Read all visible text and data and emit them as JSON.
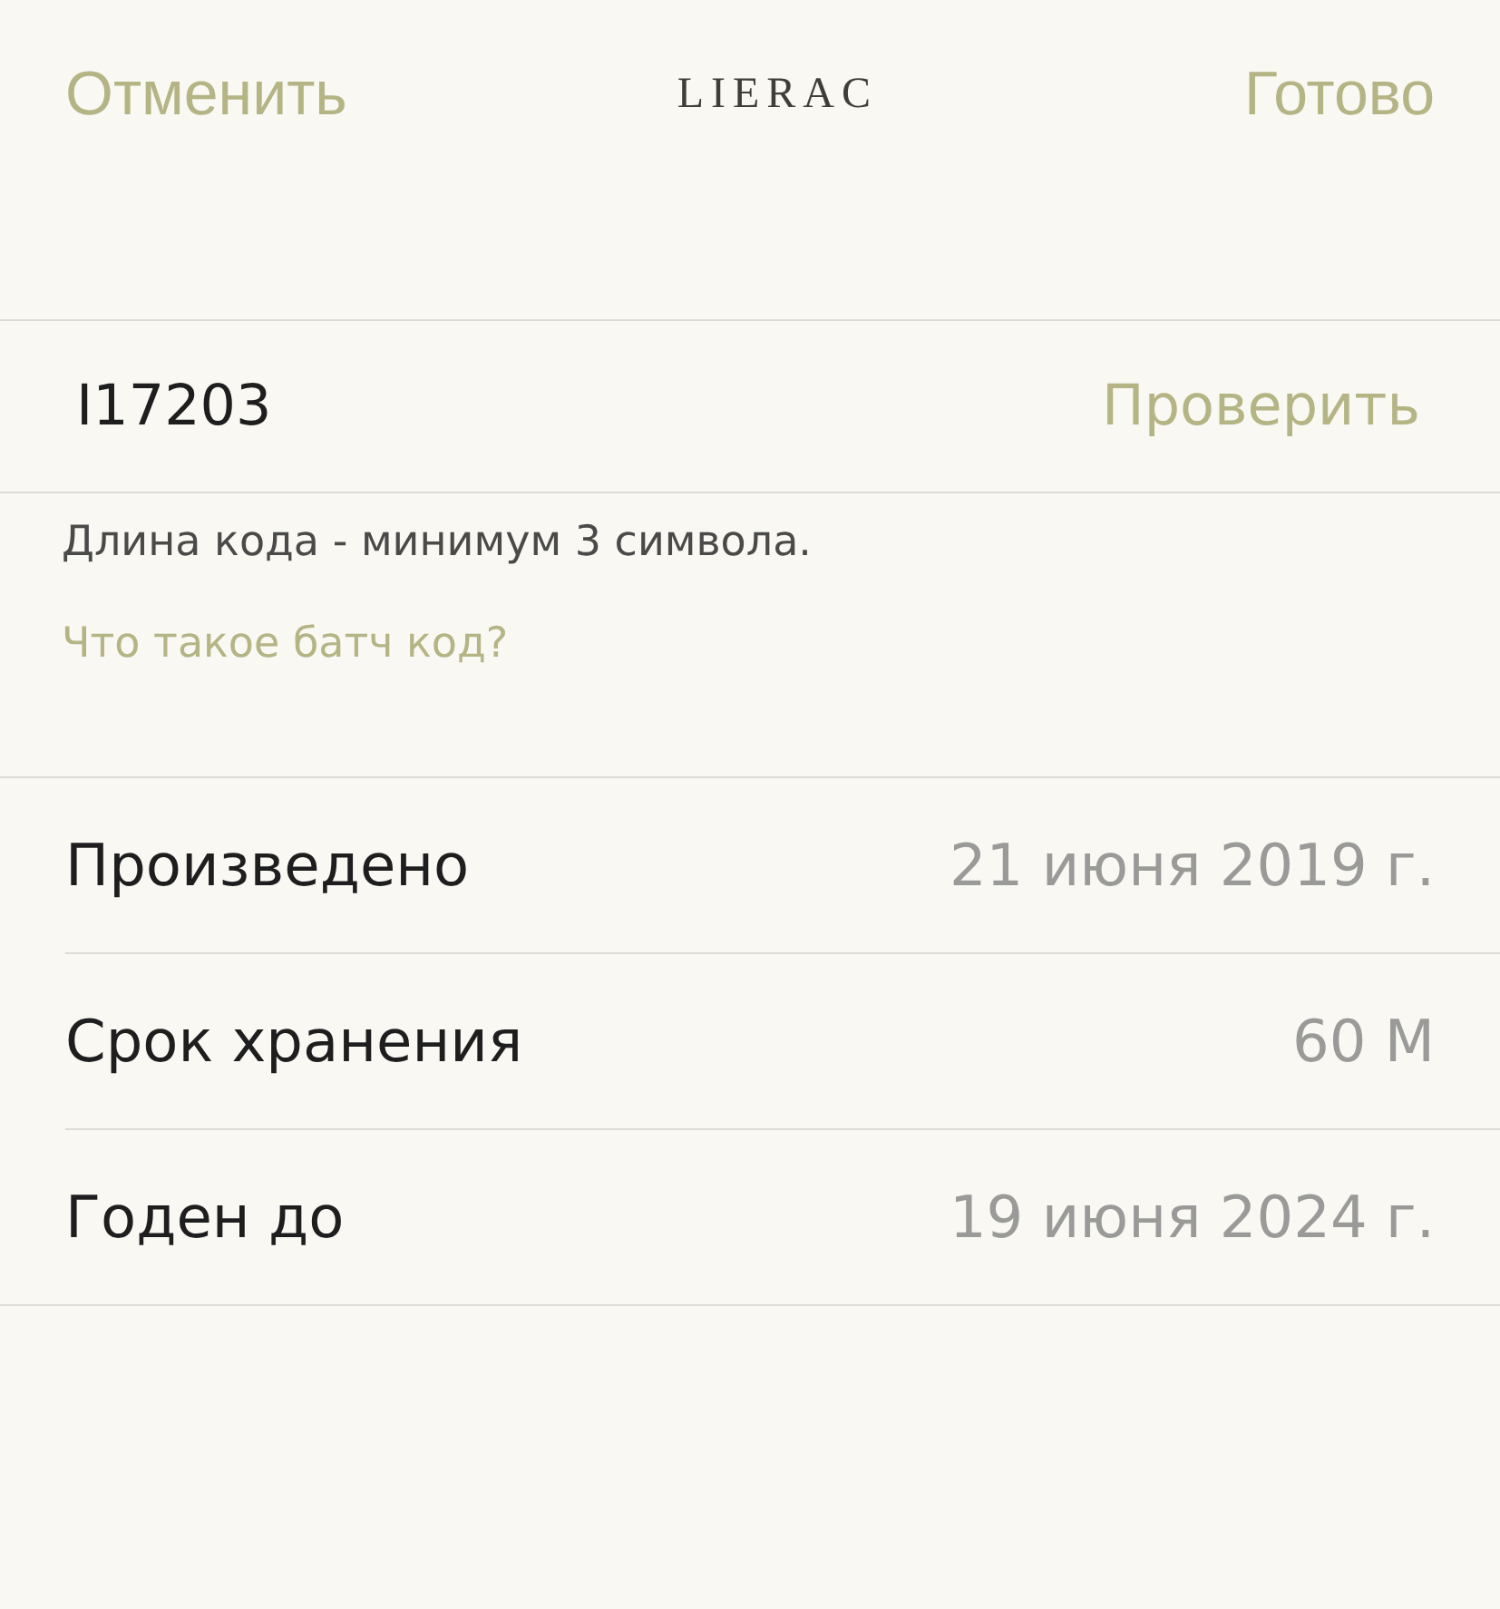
{
  "nav": {
    "cancel": "Отменить",
    "logo": "LIERAC",
    "done": "Готово"
  },
  "code_field": {
    "value": "I17203",
    "action": "Проверить"
  },
  "hint": "Длина кода - минимум 3 символа.",
  "help_link": "Что такое батч код?",
  "details": [
    {
      "label": "Произведено",
      "value": "21 июня 2019 г."
    },
    {
      "label": "Срок хранения",
      "value": "60 М"
    },
    {
      "label": "Годен до",
      "value": "19 июня 2024 г."
    }
  ]
}
